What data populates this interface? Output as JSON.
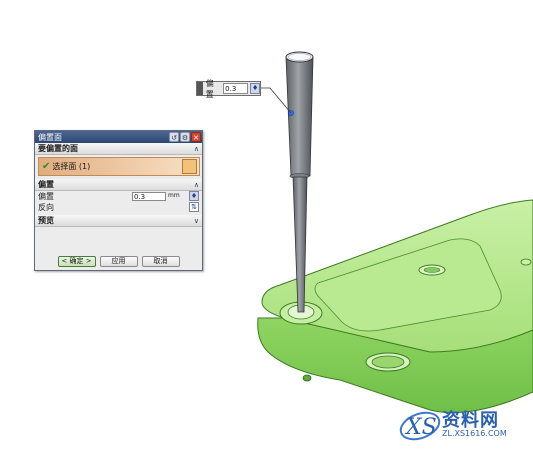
{
  "floating_input": {
    "label": "偏置",
    "value": "0.3"
  },
  "dialog": {
    "title": "偏置面",
    "section_faces": "要偏置的面",
    "select_faces": "选择面 (1)",
    "section_offset": "偏置",
    "offset_label": "偏置",
    "offset_value": "0.3",
    "offset_unit": "mm",
    "reverse_label": "反向",
    "section_preview": "预览",
    "ok_label": "< 确定 >",
    "apply_label": "应用",
    "cancel_label": "取消"
  },
  "watermark": {
    "text": "资料网",
    "url": "ZL.XS1616.COM"
  },
  "colors": {
    "part_green": "#a3e07a",
    "titlebar": "#3a5583",
    "select_row": "#e8bf95"
  }
}
